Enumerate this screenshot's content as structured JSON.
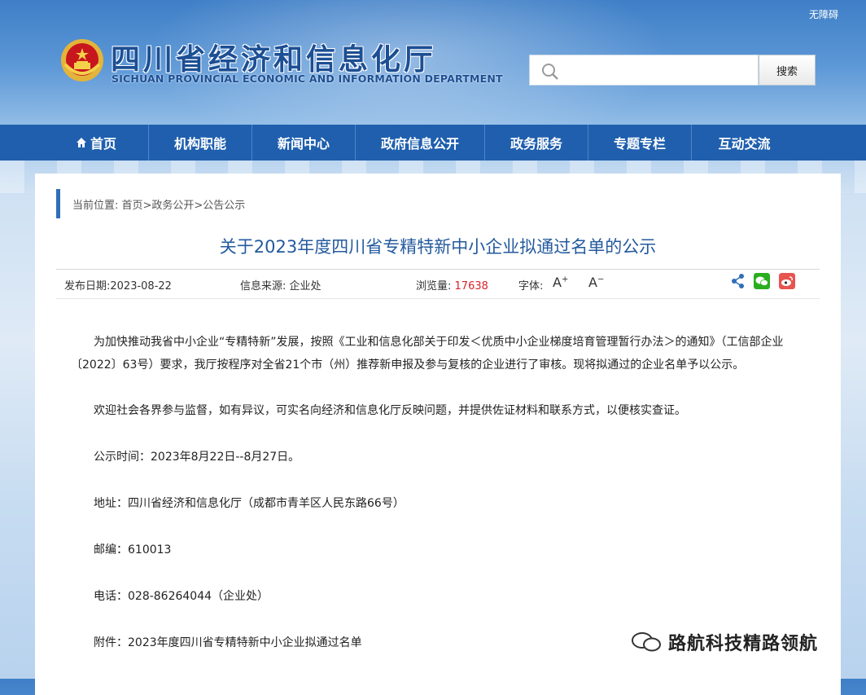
{
  "header": {
    "accessibility_label": "无障碍",
    "site_title": "四川省经济和信息化厅",
    "site_subtitle": "SICHUAN PROVINCIAL ECONOMIC AND INFORMATION DEPARTMENT",
    "search": {
      "placeholder": "",
      "button_label": "搜索"
    }
  },
  "nav": {
    "items": [
      {
        "label": "首页",
        "icon": "home-icon"
      },
      {
        "label": "机构职能"
      },
      {
        "label": "新闻中心"
      },
      {
        "label": "政府信息公开"
      },
      {
        "label": "政务服务"
      },
      {
        "label": "专题专栏"
      },
      {
        "label": "互动交流"
      }
    ]
  },
  "breadcrumb": "当前位置: 首页>政务公开>公告公示",
  "article": {
    "title": "关于2023年度四川省专精特新中小企业拟通过名单的公示",
    "meta": {
      "date_label": "发布日期:2023-08-22",
      "source_label": "信息来源:",
      "source_value": "企业处",
      "views_label": "浏览量:",
      "views_value": "17638",
      "font_label": "字体:",
      "font_increase": "A",
      "font_decrease": "A"
    },
    "paragraphs": {
      "p1_line1": "为加快推动我省中小企业“专精特新”发展，按照《工业和信息化部关于印发＜优质中小企业梯度培育管理暂行办法＞的通知》（工信部企业",
      "p1_line2": "〔2022〕63号）要求，我厅按程序对全省21个市（州）推荐新申报及参与复核的企业进行了审核。现将拟通过的企业名单予以公示。",
      "p2": "欢迎社会各界参与监督，如有异议，可实名向经济和信息化厅反映问题，并提供佐证材料和联系方式，以便核实查证。",
      "p3": "公示时间：2023年8月22日--8月27日。",
      "p4": "地址：四川省经济和信息化厅（成都市青羊区人民东路66号）",
      "p5": "邮编：610013",
      "p6": "电话：028-86264044（企业处）",
      "p7": "附件：2023年度四川省专精特新中小企业拟通过名单"
    }
  },
  "share_icons": [
    "share-icon",
    "wechat-icon",
    "weibo-icon"
  ],
  "watermark": "路航科技精路领航",
  "colors": {
    "nav_bg": "#1f5fae",
    "title": "#245a9e",
    "views": "#d9232d",
    "wechat": "#2aae1f",
    "weibo": "#e8544f"
  }
}
